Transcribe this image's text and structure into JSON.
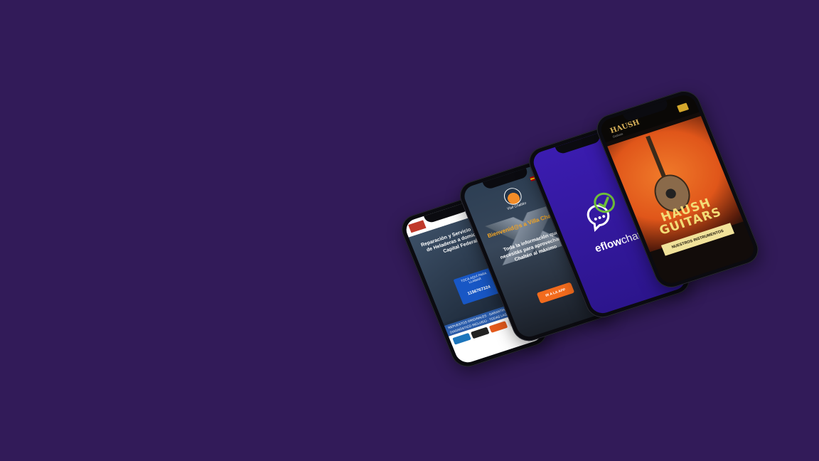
{
  "background_color": "#321b59",
  "phones": [
    {
      "id": "repair",
      "hero_text": "Reparación y Servicio Técnico de Heladeras a domicilio en Capital Federal",
      "call_label": "TOCÁ AQUÍ PARA LLAMAR",
      "phone_number": "1156767324",
      "strip_text": "REPUESTOS ORIGINALES · GARANTÍA ESCRITA · DIAGNÓSTICO INCLUIDO · TODAS LAS MARCAS"
    },
    {
      "id": "chalten",
      "brand": "Visit Chaltén",
      "welcome": "Bienvenid@s a Villa Chaltén",
      "body": "Toda la información que necesitás para aprovechar El Chaltén al máximo",
      "cta": "IR A LA APP"
    },
    {
      "id": "eflowchat",
      "logo_bold": "eflow",
      "logo_light": "chat",
      "accent": "#6fbf3a"
    },
    {
      "id": "haush",
      "brand": "HAUSH",
      "brand_sub": "Guitars",
      "title": "HAUSH GUITARS",
      "button": "NUESTROS INSTRUMENTOS"
    }
  ]
}
